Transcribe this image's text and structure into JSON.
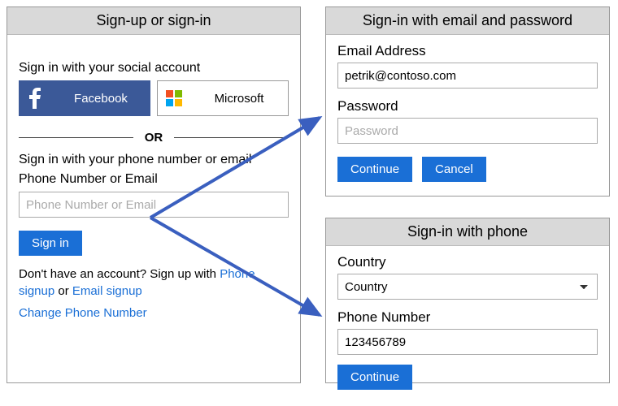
{
  "left": {
    "title": "Sign-up or sign-in",
    "social_heading": "Sign in with your social account",
    "facebook_label": "Facebook",
    "microsoft_label": "Microsoft",
    "or_text": "OR",
    "phone_email_heading": "Sign in with your phone number or email",
    "phone_email_label": "Phone Number or Email",
    "phone_email_placeholder": "Phone Number or Email",
    "signin_label": "Sign in",
    "signup_prefix": "Don't have an account? Sign up with ",
    "phone_signup_link": "Phone signup",
    "or_word": " or ",
    "email_signup_link": "Email signup",
    "change_phone_link": "Change Phone Number"
  },
  "email_panel": {
    "title": "Sign-in with email and password",
    "email_label": "Email Address",
    "email_value": "petrik@contoso.com",
    "password_label": "Password",
    "password_placeholder": "Password",
    "continue_label": "Continue",
    "cancel_label": "Cancel"
  },
  "phone_panel": {
    "title": "Sign-in with phone",
    "country_label": "Country",
    "country_value": "Country",
    "phone_label": "Phone Number",
    "phone_value": "123456789",
    "continue_label": "Continue"
  },
  "colors": {
    "accent": "#1a6fd6",
    "header_bg": "#d9d9d9",
    "facebook": "#3b5998"
  }
}
